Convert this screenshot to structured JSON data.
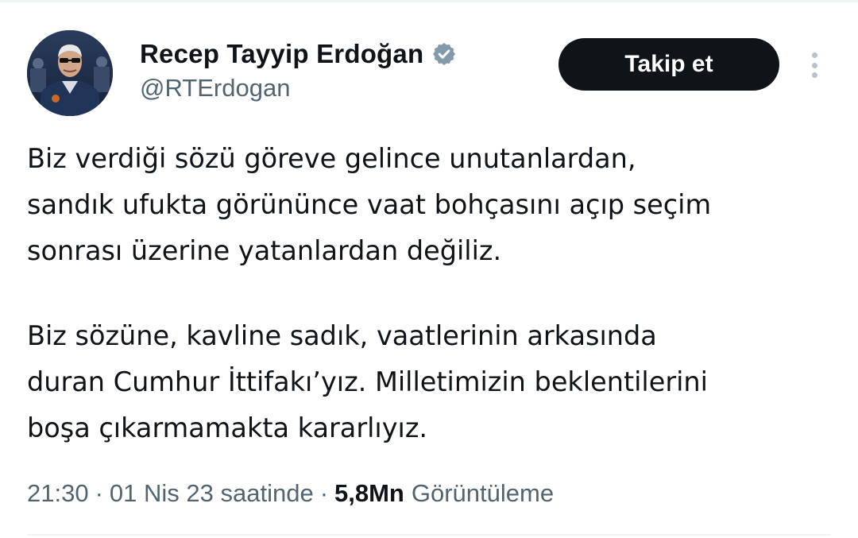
{
  "author": {
    "display_name": "Recep Tayyip Erdoğan",
    "handle": "@RTErdogan",
    "verified": true,
    "verified_color": "#829aab"
  },
  "actions": {
    "follow_label": "Takip et",
    "more_icon": "more-vertical-icon"
  },
  "tweet": {
    "paragraph1": [
      "Biz verdiği sözü göreve gelince unutanlardan,",
      "sandık ufukta görününce vaat bohçasını açıp seçim",
      "sonrası üzerine yatanlardan değiliz."
    ],
    "paragraph2": [
      "Biz sözüne, kavline sadık, vaatlerinin arkasında",
      "duran Cumhur İttifakı’yız. Milletimizin beklentilerini",
      "boşa çıkarmamakta kararlıyız."
    ]
  },
  "meta": {
    "time": "21:30",
    "date": "01 Nis 23 saatinde",
    "separator": "·",
    "views_count": "5,8Mn",
    "views_label": "Görüntüleme"
  },
  "colors": {
    "text_primary": "#0f1419",
    "text_secondary": "#536471",
    "button_bg": "#0f1419",
    "divider": "#eff3f4"
  }
}
